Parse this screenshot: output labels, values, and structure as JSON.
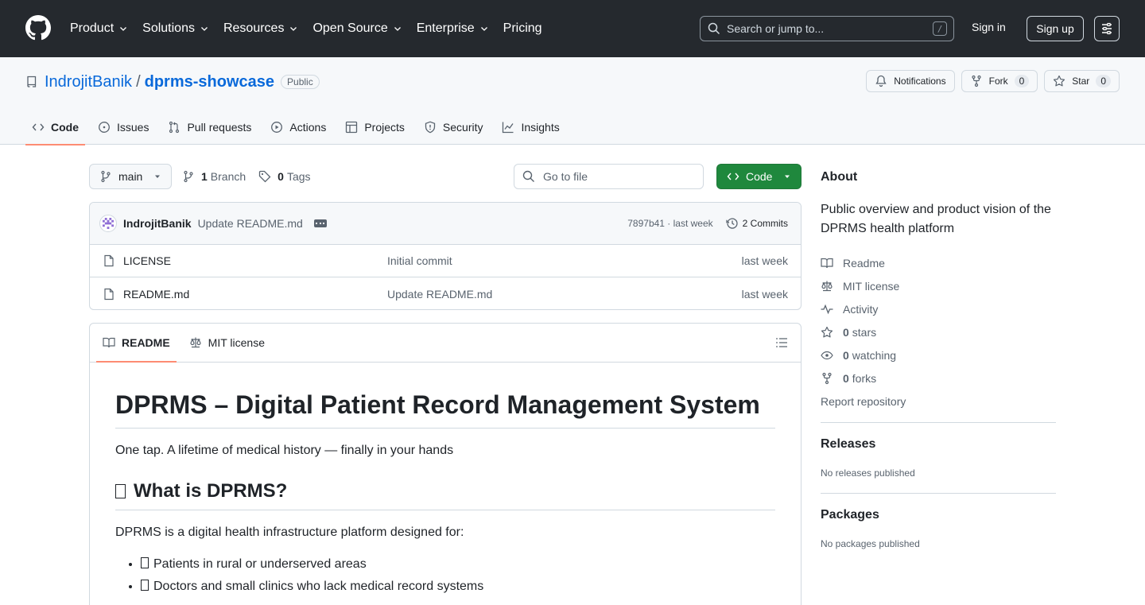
{
  "header": {
    "nav": [
      {
        "label": "Product",
        "dropdown": true
      },
      {
        "label": "Solutions",
        "dropdown": true
      },
      {
        "label": "Resources",
        "dropdown": true
      },
      {
        "label": "Open Source",
        "dropdown": true
      },
      {
        "label": "Enterprise",
        "dropdown": true
      },
      {
        "label": "Pricing",
        "dropdown": false
      }
    ],
    "search_placeholder": "Search or jump to...",
    "search_shortcut": "/",
    "sign_in": "Sign in",
    "sign_up": "Sign up"
  },
  "repo": {
    "owner": "IndrojitBanik",
    "separator": "/",
    "name": "dprms-showcase",
    "visibility": "Public",
    "notifications_label": "Notifications",
    "fork_label": "Fork",
    "fork_count": "0",
    "star_label": "Star",
    "star_count": "0",
    "tabs": [
      "Code",
      "Issues",
      "Pull requests",
      "Actions",
      "Projects",
      "Security",
      "Insights"
    ]
  },
  "toolbar": {
    "branch": "main",
    "branch_count": "1",
    "branch_label": "Branch",
    "tag_count": "0",
    "tag_label": "Tags",
    "goto_file": "Go to file",
    "code_button": "Code"
  },
  "commit": {
    "author": "IndrojitBanik",
    "message": "Update README.md",
    "sha_time": "7897b41 · last week",
    "commits_label": "2 Commits"
  },
  "files": [
    {
      "name": "LICENSE",
      "message": "Initial commit",
      "date": "last week"
    },
    {
      "name": "README.md",
      "message": "Update README.md",
      "date": "last week"
    }
  ],
  "readme": {
    "tab_readme": "README",
    "tab_license": "MIT license",
    "title": "DPRMS – Digital Patient Record Management System",
    "tagline": "One tap. A lifetime of medical history — finally in your hands",
    "h2": "What is DPRMS?",
    "intro": "DPRMS is a digital health infrastructure platform designed for:",
    "bullets": [
      "Patients in rural or underserved areas",
      "Doctors and small clinics who lack medical record systems"
    ]
  },
  "sidebar": {
    "about_title": "About",
    "description": "Public overview and product vision of the DPRMS health platform",
    "readme": "Readme",
    "license": "MIT license",
    "activity": "Activity",
    "stars_count": "0",
    "stars_label": "stars",
    "watching_count": "0",
    "watching_label": "watching",
    "forks_count": "0",
    "forks_label": "forks",
    "report": "Report repository",
    "releases_title": "Releases",
    "releases_text": "No releases published",
    "packages_title": "Packages",
    "packages_text": "No packages published"
  },
  "colors": {
    "header_bg": "#25292e",
    "link": "#0969da",
    "code_button": "#1f883d",
    "active_tab_underline": "#fd8c73"
  }
}
